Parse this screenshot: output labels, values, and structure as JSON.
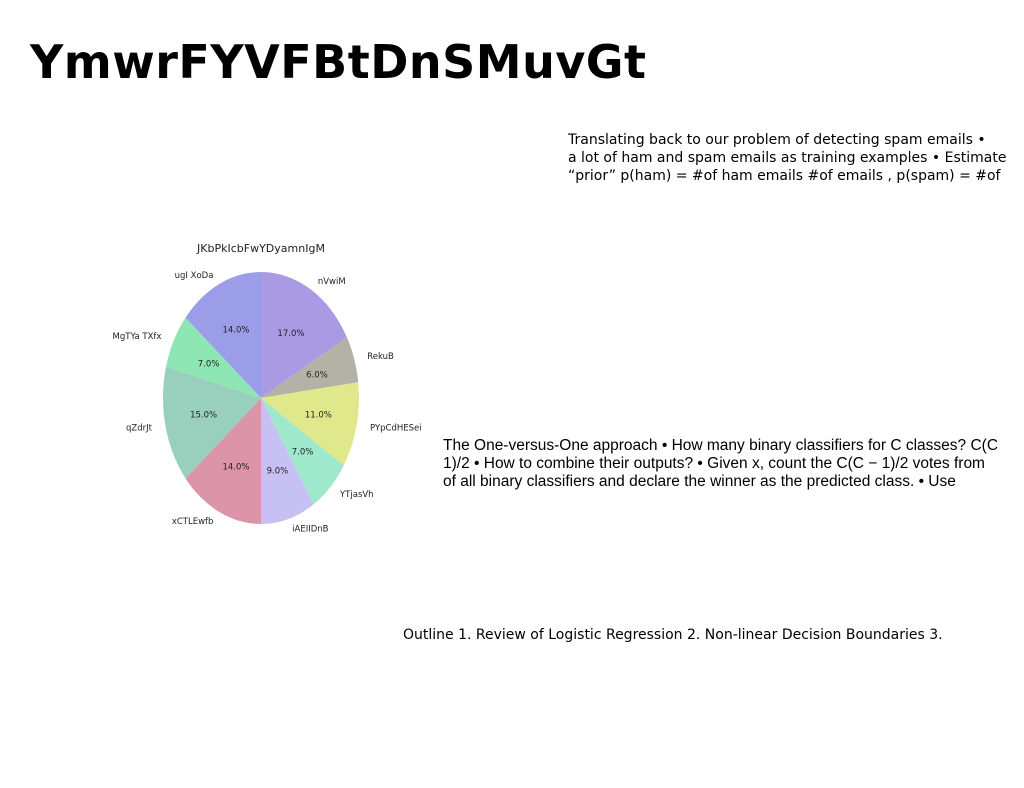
{
  "title": "YmwrFYVFBtDnSMuvGt",
  "paragraphs": {
    "spam": "Translating back to our problem of detecting spam emails •\na lot of ham and spam emails as training examples • Estimate\n“prior” p(ham) = #of ham emails #of emails , p(spam) = #of",
    "ovo": "The One-versus-One approach • How many binary classifiers for C classes? C(C\n1)/2 • How to combine their outputs? • Given x, count the C(C − 1)/2 votes from\nof all binary classifiers and declare the winner as the predicted class. • Use",
    "outline": "Outline 1. Review of Logistic Regression 2. Non-linear Decision Boundaries 3."
  },
  "chart_data": {
    "type": "pie",
    "title": "JKbPkIcbFwYDyamnIgM",
    "start_angle": "top, clockwise",
    "slices": [
      {
        "label": "nVwiM",
        "value": 17.0,
        "pct_label": "17.0%",
        "color": "#a99ae3"
      },
      {
        "label": "RekuB",
        "value": 6.0,
        "pct_label": "6.0%",
        "color": "#b2b3a6"
      },
      {
        "label": "PYpCdHESei",
        "value": 11.0,
        "pct_label": "11.0%",
        "color": "#e0e88c"
      },
      {
        "label": "YTjasVh",
        "value": 7.0,
        "pct_label": "7.0%",
        "color": "#9ee8cb"
      },
      {
        "label": "iAEIIDnB",
        "value": 9.0,
        "pct_label": "9.0%",
        "color": "#c7c0f2"
      },
      {
        "label": "xCTLEwfb",
        "value": 14.0,
        "pct_label": "14.0%",
        "color": "#dc94a9"
      },
      {
        "label": "qZdrJt",
        "value": 15.0,
        "pct_label": "15.0%",
        "color": "#98d0bd"
      },
      {
        "label": "MgTYa TXfx",
        "value": 7.0,
        "pct_label": "7.0%",
        "color": "#8de6b3"
      },
      {
        "label": "ugI XoDa",
        "value": 14.0,
        "pct_label": "14.0%",
        "color": "#9c9de8"
      }
    ]
  }
}
